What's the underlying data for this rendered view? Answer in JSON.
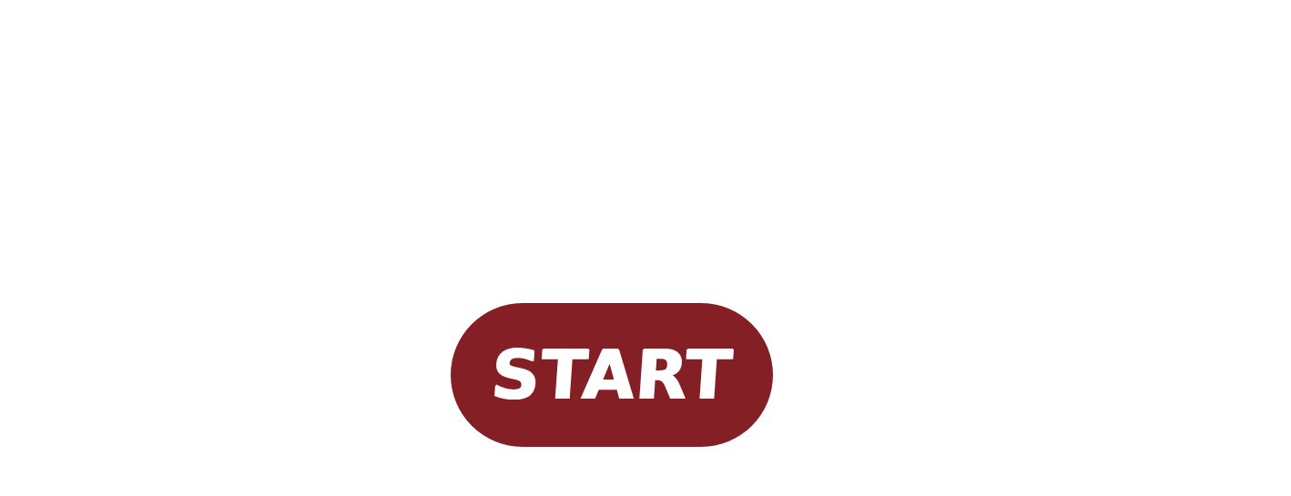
{
  "start_button": {
    "label": "START"
  },
  "colors": {
    "background": "#ffffff",
    "button": "#841f25",
    "button_text": "#ffffff"
  }
}
